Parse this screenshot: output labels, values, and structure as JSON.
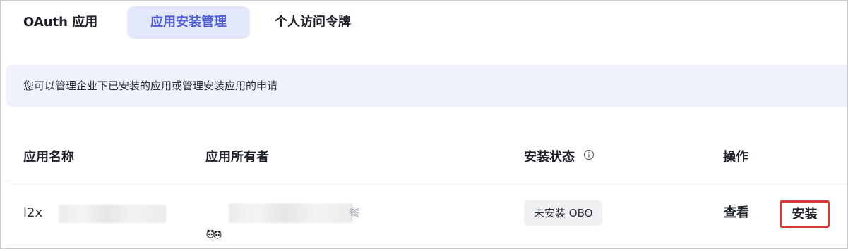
{
  "tabs": [
    {
      "label": "OAuth 应用",
      "active": false
    },
    {
      "label": "应用安装管理",
      "active": true
    },
    {
      "label": "个人访问令牌",
      "active": false
    }
  ],
  "notice": {
    "text": "您可以管理企业下已安装的应用或管理安装应用的申请"
  },
  "table": {
    "columns": {
      "name": "应用名称",
      "owner": "应用所有者",
      "status": "安装状态",
      "actions": "操作"
    },
    "rows": [
      {
        "name_visible": "l2x",
        "owner_visible_tail": "餐",
        "status": "未安装 OBO",
        "actions": {
          "view": "查看",
          "install": "安装"
        }
      }
    ]
  },
  "colors": {
    "active_tab_bg": "#e4e8fb",
    "active_tab_text": "#4e5bd6",
    "notice_bg": "#eff1fd",
    "highlight_border": "#d63b3b"
  },
  "icons": {
    "status_info": "info-circle-icon",
    "owner_avatar": "panda-avatar-icon"
  }
}
